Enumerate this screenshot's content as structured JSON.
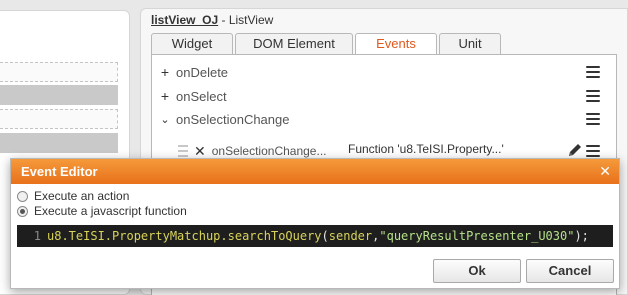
{
  "panel": {
    "name": "listView_OJ",
    "separator": " - ",
    "type": "ListView"
  },
  "tabs": [
    {
      "label": "Widget",
      "active": false
    },
    {
      "label": "DOM Element",
      "active": false
    },
    {
      "label": "Events",
      "active": true
    },
    {
      "label": "Unit",
      "active": false
    }
  ],
  "events": [
    {
      "label": "onDelete",
      "icon": "plus-icon"
    },
    {
      "label": "onSelect",
      "icon": "plus-icon"
    },
    {
      "label": "onSelectionChange",
      "icon": "chevron-down-icon"
    }
  ],
  "handler": {
    "label": "onSelectionChange...",
    "value": "Function 'u8.TeISI.Property...'"
  },
  "dialog": {
    "title": "Event Editor",
    "options": [
      {
        "label": "Execute an action",
        "checked": false
      },
      {
        "label": "Execute a javascript function",
        "checked": true
      }
    ],
    "code": {
      "line_number": "1",
      "id_part": "u8.TeISI.PropertyMatchup.searchToQuery",
      "open": "(",
      "arg1": "sender",
      "comma": ",",
      "arg2": "\"queryResultPresenter_U030\"",
      "close": ");"
    },
    "ok_label": "Ok",
    "cancel_label": "Cancel"
  },
  "colors": {
    "accent": "#e0591c",
    "dialog_header": "#f08a2e",
    "code_bg": "#1e1e1e"
  }
}
